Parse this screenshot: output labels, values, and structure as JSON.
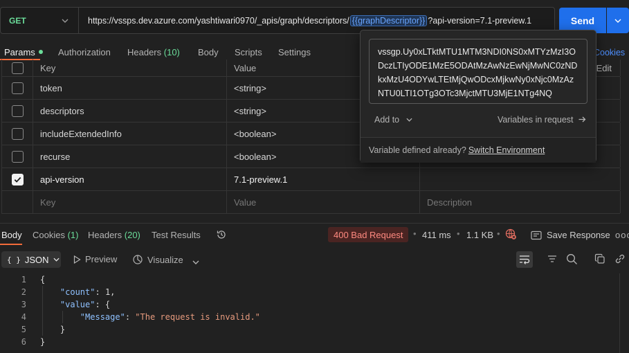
{
  "request": {
    "method": "GET",
    "url_prefix": "https://vssps.dev.azure.com/yashtiwari0970/_apis/graph/descriptors/",
    "url_variable": "{{graphDescriptor}}",
    "url_suffix": "?api-version=7.1-preview.1",
    "send_label": "Send"
  },
  "request_tabs": {
    "params": "Params",
    "authorization": "Authorization",
    "headers": "Headers",
    "headers_count": "(10)",
    "body": "Body",
    "scripts": "Scripts",
    "settings": "Settings",
    "cookies": "Cookies"
  },
  "params_table": {
    "headers": {
      "key": "Key",
      "value": "Value",
      "bulk_edit": "Edit"
    },
    "rows": [
      {
        "key": "token",
        "value": "<string>",
        "checked": false
      },
      {
        "key": "descriptors",
        "value": "<string>",
        "checked": false
      },
      {
        "key": "includeExtendedInfo",
        "value": "<boolean>",
        "checked": false
      },
      {
        "key": "recurse",
        "value": "<boolean>",
        "checked": false
      },
      {
        "key": "api-version",
        "value": "7.1-preview.1",
        "checked": true
      }
    ],
    "placeholder": {
      "key": "Key",
      "value": "Value",
      "description": "Description"
    }
  },
  "popover": {
    "value": "vssgp.Uy0xLTktMTU1MTM3NDI0NS0xMTYzMzI3ODczLTIyODE1MzE5ODAtMzAwNzEwNjMwNC0zNDkxMzU4ODYwLTEtMjQwODcxMjkwNy0xNjc0MzAzNTU0LTI1OTg3OTc3MjctMTU3MjE1NTg4NQ",
    "add_to": "Add to",
    "variables": "Variables in request",
    "footer_text": "Variable defined already?",
    "footer_link": "Switch Environment"
  },
  "response_tabs": {
    "body": "Body",
    "cookies": "Cookies",
    "cookies_count": "(1)",
    "headers": "Headers",
    "headers_count": "(20)",
    "tests": "Test Results"
  },
  "response_meta": {
    "status": "400 Bad Request",
    "time": "411 ms",
    "size": "1.1 KB",
    "save": "Save Response",
    "more": "ooo"
  },
  "response_toolbar": {
    "format": "JSON",
    "preview": "Preview",
    "visualize": "Visualize"
  },
  "response_body": {
    "line_numbers": [
      "1",
      "2",
      "3",
      "4",
      "5",
      "6"
    ],
    "count_key": "\"count\"",
    "count_value": "1",
    "value_key": "\"value\"",
    "message_key": "\"Message\"",
    "message_value": "\"The request is invalid.\""
  },
  "colors": {
    "accent": "#f26b3a",
    "send": "#1f6feb",
    "get_method": "#6bdd9a",
    "error": "#ff8a80"
  }
}
